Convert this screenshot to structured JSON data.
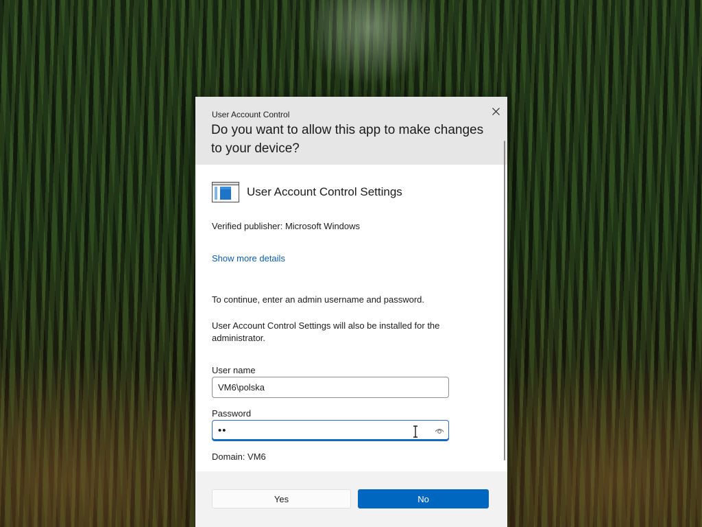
{
  "dialog": {
    "caption": "User Account Control",
    "question": "Do you want to allow this app to make changes to your device?",
    "app_name": "User Account Control Settings",
    "app_icon": "uac-settings-window-icon",
    "publisher": "Verified publisher: Microsoft Windows",
    "details_link": "Show more details",
    "instructions": "To continue, enter an admin username and password.",
    "install_note": "User Account Control Settings will also be installed for the administrator.",
    "username": {
      "label": "User name",
      "value": "VM6\\polska"
    },
    "password": {
      "label": "Password",
      "value": "••",
      "reveal_icon": "eye-icon"
    },
    "domain": "Domain: VM6",
    "buttons": {
      "yes": "Yes",
      "no": "No"
    },
    "close_icon": "close-icon"
  },
  "colors": {
    "accent": "#0067c0",
    "link": "#0b5cad",
    "header_bg": "#e6e6e6",
    "footer_bg": "#f2f2f2"
  }
}
